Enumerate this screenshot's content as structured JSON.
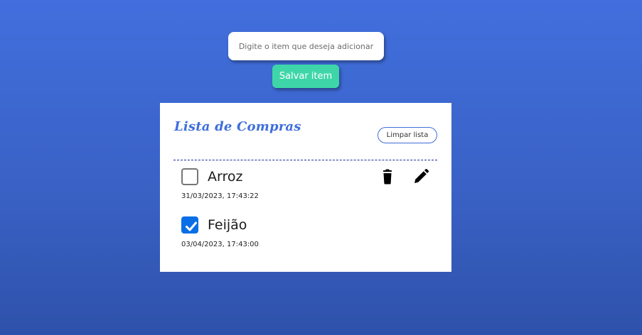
{
  "form": {
    "input_placeholder": "Digite o item que deseja adicionar",
    "input_value": "",
    "save_label": "Salvar item"
  },
  "list": {
    "title": "Lista de Compras",
    "clear_label": "Limpar lista",
    "items": [
      {
        "name": "Arroz",
        "date": "31/03/2023, 17:43:22",
        "checked": false,
        "icons": [
          "trash-icon",
          "pencil-icon"
        ]
      },
      {
        "name": "Feijão",
        "date": "03/04/2023, 17:43:00",
        "checked": true,
        "icons": []
      }
    ]
  },
  "colors": {
    "background_top": "#416fdd",
    "background_bottom": "#2e52ab",
    "save_button": "#3ed6a8",
    "title": "#3f6fdb",
    "checkbox_checked": "#0a6fe6",
    "divider": "#1a2d9c"
  }
}
